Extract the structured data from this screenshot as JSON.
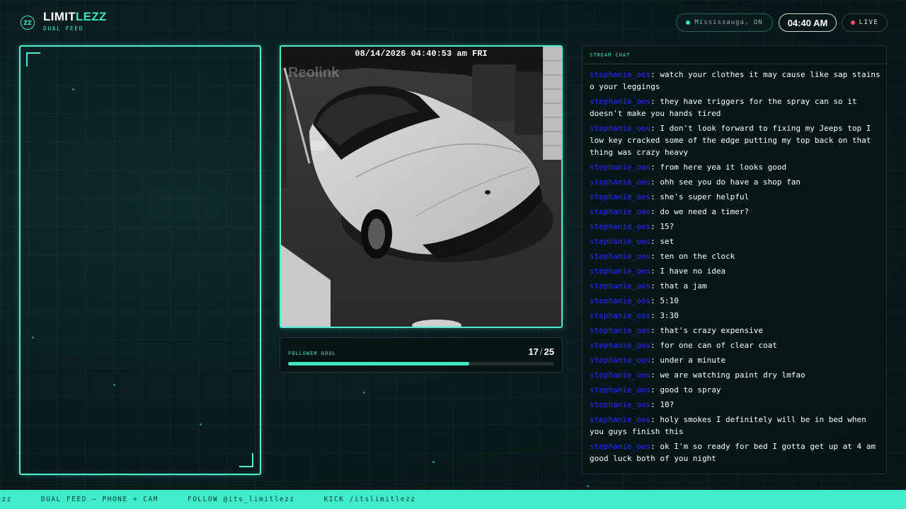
{
  "header": {
    "logo_badge": "ZZ",
    "brand_main": "LIMIT",
    "brand_accent": "LEZZ",
    "brand_sub": "DUAL FEED",
    "location": "Mississauga, ON",
    "time": "04:40 AM",
    "live_label": "LIVE",
    "live_color": "#ff4a5e",
    "accent_color": "#3ee6c4"
  },
  "camera": {
    "timestamp": "08/14/2026 04:40:53 am FRI",
    "watermark": "Reolink"
  },
  "follower_goal": {
    "label": "FOLLOWER GOAL",
    "current": "17",
    "target": "25",
    "separator": "/",
    "progress_fraction": 0.68
  },
  "chat": {
    "header": "STREAM CHAT",
    "username_color": "#2a2cff",
    "messages": [
      {
        "user": "stephanie_oos",
        "text": "watch your clothes it may cause like sap stains o your leggings"
      },
      {
        "user": "stephanie_oos",
        "text": "they have triggers for the spray can so it doesn't make you hands tired"
      },
      {
        "user": "stephanie_oos",
        "text": "I don't look forward to fixing my Jeeps top I low key cracked some of the edge putting my top back on that thing was crazy heavy"
      },
      {
        "user": "stephanie_oos",
        "text": "from here yea it looks good"
      },
      {
        "user": "stephanie_oos",
        "text": "ohh see you do have a shop fan"
      },
      {
        "user": "stephanie_oos",
        "text": "she's super helpful"
      },
      {
        "user": "stephanie_oos",
        "text": "do we need a timer?"
      },
      {
        "user": "stephanie_oos",
        "text": "15?"
      },
      {
        "user": "stephanie_oos",
        "text": "set"
      },
      {
        "user": "stephanie_oos",
        "text": "ten on the clock"
      },
      {
        "user": "stephanie_oos",
        "text": "I have no idea"
      },
      {
        "user": "stephanie_oos",
        "text": "that a jam"
      },
      {
        "user": "stephanie_oos",
        "text": "5:10"
      },
      {
        "user": "stephanie_oos",
        "text": "3:30"
      },
      {
        "user": "stephanie_oos",
        "text": "that's crazy expensive"
      },
      {
        "user": "stephanie_oos",
        "text": "for one can of clear coat"
      },
      {
        "user": "stephanie_oos",
        "text": "under a minute"
      },
      {
        "user": "stephanie_oos",
        "text": "we are watching paint dry lmfao"
      },
      {
        "user": "stephanie_oos",
        "text": "good to spray"
      },
      {
        "user": "stephanie_oos",
        "text": "10?"
      },
      {
        "user": "stephanie_oos",
        "text": "holy smokes I definitely will be in bed when you guys finish this"
      },
      {
        "user": "stephanie_oos",
        "text": "ok I'm so ready for bed I gotta get up at 4 am good luck both of you night"
      }
    ]
  },
  "ticker": {
    "items": [
      "lezz",
      "DUAL FEED — PHONE + CAM",
      "FOLLOW @its_limitlezz",
      "KICK /itslimitlezz"
    ]
  }
}
